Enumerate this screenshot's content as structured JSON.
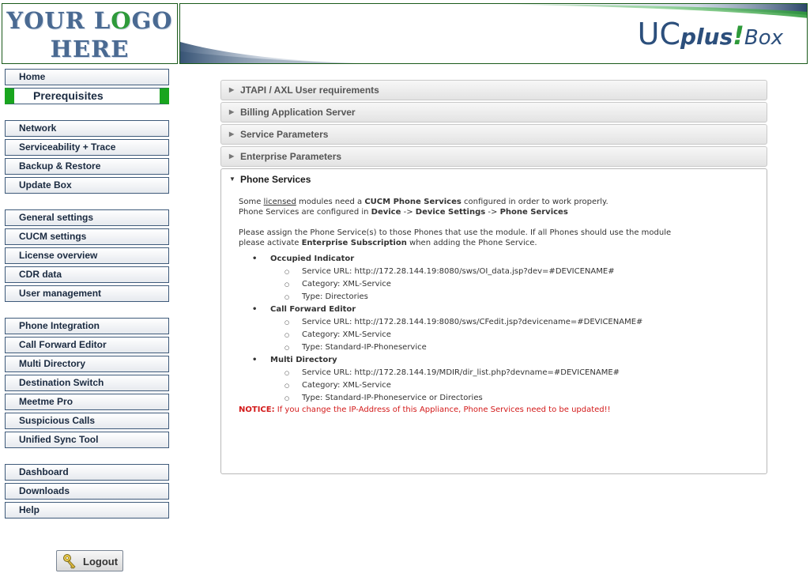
{
  "header": {
    "logo_line1_a": "YOUR L",
    "logo_line1_o": "O",
    "logo_line1_b": "GO",
    "logo_line2": "HERE",
    "brand": {
      "uc": "UC",
      "plus": "plus",
      "excl": "!",
      "box": "Box"
    },
    "colors": {
      "green": "#19a51e",
      "navy": "#2c4f7c"
    }
  },
  "sidebar": {
    "groups": [
      [
        "Home",
        "Prerequisites"
      ],
      [
        "Network",
        "Serviceability + Trace",
        "Backup & Restore",
        "Update Box"
      ],
      [
        "General settings",
        "CUCM settings",
        "License overview",
        "CDR data",
        "User management"
      ],
      [
        "Phone Integration",
        "Call Forward Editor",
        "Multi Directory",
        "Destination Switch",
        "Meetme Pro",
        "Suspicious Calls",
        "Unified Sync Tool"
      ],
      [
        "Dashboard",
        "Downloads",
        "Help"
      ]
    ],
    "active": "Prerequisites",
    "logout_label": "Logout"
  },
  "accordion": {
    "collapsed": [
      "JTAPI / AXL User requirements",
      "Billing Application Server",
      "Service Parameters",
      "Enterprise Parameters"
    ],
    "expanded_title": "Phone Services"
  },
  "content": {
    "p1": {
      "t1": "Some ",
      "link": "licensed",
      "t2": " modules need a ",
      "b1": "CUCM Phone Services",
      "t3": " configured in order to work properly."
    },
    "p2": {
      "t1": "Phone Services are configured in ",
      "b1": "Device",
      "t2": " -> ",
      "b2": "Device Settings",
      "t3": " -> ",
      "b3": "Phone Services"
    },
    "p3": {
      "line1": "Please assign the Phone Service(s) to those Phones that use the module. If all Phones should use the module",
      "t1": "please activate ",
      "b1": "Enterprise Subscription",
      "t2": " when adding the Phone Service."
    },
    "services": [
      {
        "name": "Occupied Indicator",
        "url": "Service URL: http://172.28.144.19:8080/sws/OI_data.jsp?dev=#DEVICENAME#",
        "category": "Category: XML-Service",
        "type": "Type: Directories"
      },
      {
        "name": "Call Forward Editor",
        "url": "Service URL: http://172.28.144.19:8080/sws/CFedit.jsp?devicename=#DEVICENAME#",
        "category": "Category: XML-Service",
        "type": "Type: Standard-IP-Phoneservice"
      },
      {
        "name": "Multi Directory",
        "url": "Service URL: http://172.28.144.19/MDIR/dir_list.php?devname=#DEVICENAME#",
        "category": "Category: XML-Service",
        "type": "Type: Standard-IP-Phoneservice or Directories"
      }
    ],
    "notice_label": "NOTICE:",
    "notice_text": " If you change the IP-Address of this Appliance, Phone Services need to be updated!!"
  }
}
